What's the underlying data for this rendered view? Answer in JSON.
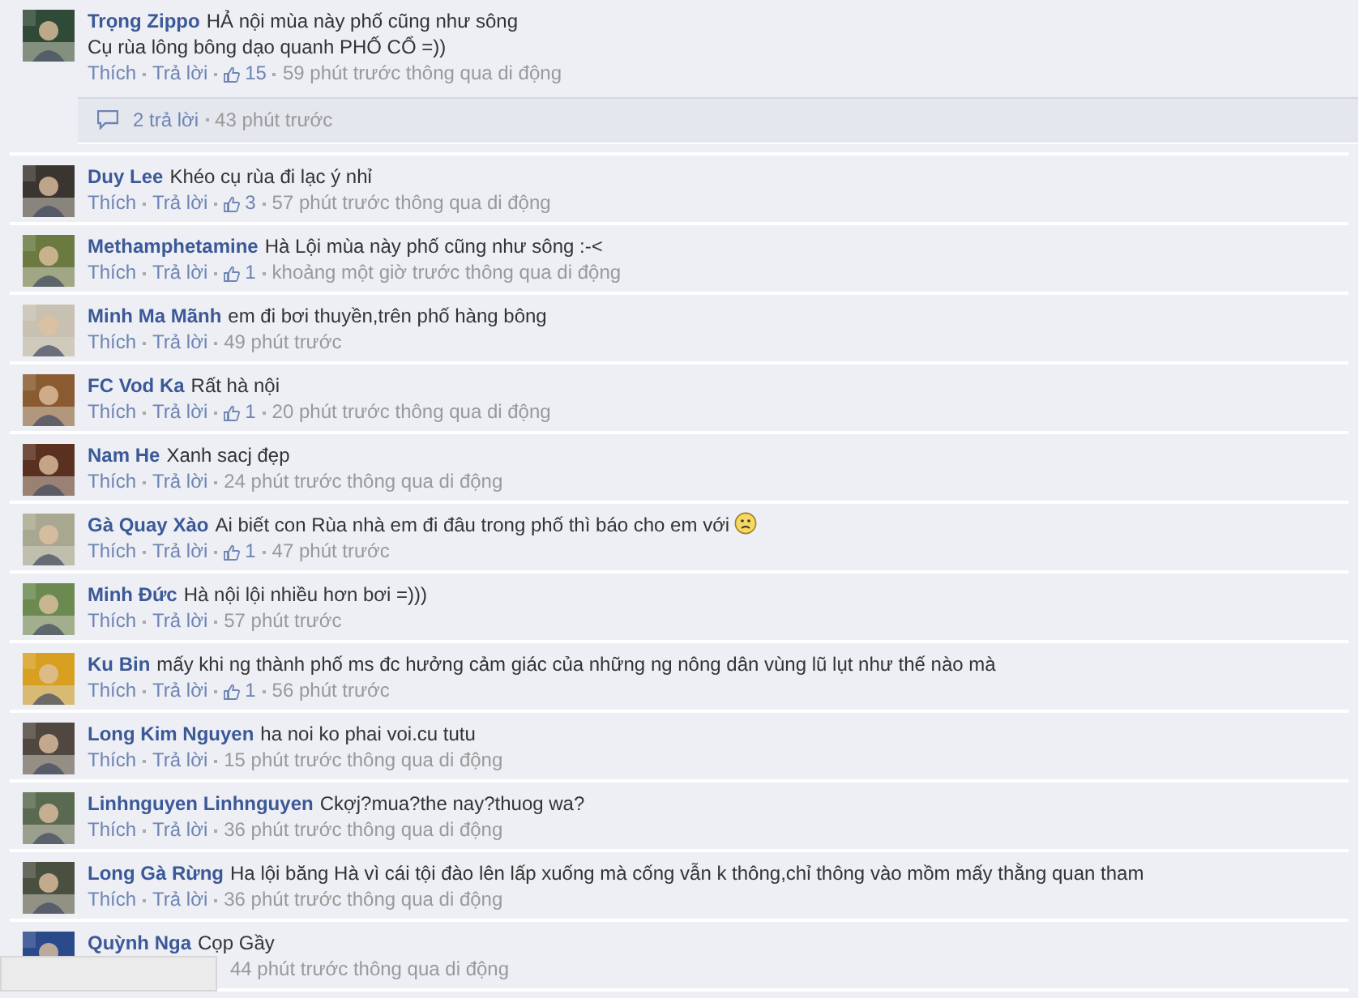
{
  "comments": [
    {
      "author": "Trọng Zippo",
      "lines": [
        "HẢ nội mùa này phố cũng như sông",
        "Cụ rùa lông bông dạo quanh PHỐ CỔ =))"
      ],
      "actions": [
        "Thích",
        "Trả lời"
      ],
      "likes": "15",
      "time": "59 phút trước thông qua di động",
      "replies": {
        "count": "2 trả lời",
        "time": "43 phút trước"
      }
    },
    {
      "author": "Duy Lee",
      "lines": [
        "Khéo cụ rùa đi lạc ý nhỉ"
      ],
      "actions": [
        "Thích",
        "Trả lời"
      ],
      "likes": "3",
      "time": "57 phút trước thông qua di động"
    },
    {
      "author": "Methamphetamine",
      "lines": [
        "Hà Lội mùa này phố cũng như sông :-<"
      ],
      "actions": [
        "Thích",
        "Trả lời"
      ],
      "likes": "1",
      "time": "khoảng một giờ trước thông qua di động"
    },
    {
      "author": "Minh Ma Mãnh",
      "lines": [
        "em đi bơi thuyền,trên phố hàng bông"
      ],
      "actions": [
        "Thích",
        "Trả lời"
      ],
      "time": "49 phút trước"
    },
    {
      "author": "FC Vod Ka",
      "lines": [
        "Rất hà nội"
      ],
      "actions": [
        "Thích",
        "Trả lời"
      ],
      "likes": "1",
      "time": "20 phút trước thông qua di động"
    },
    {
      "author": "Nam He",
      "lines": [
        "Xanh sacj đẹp"
      ],
      "actions": [
        "Thích",
        "Trả lời"
      ],
      "time": "24 phút trước thông qua di động"
    },
    {
      "author": "Gà Quay Xào",
      "lines": [
        "Ai biết con Rùa nhà em đi đâu trong phố thì báo cho em với"
      ],
      "emoticon": true,
      "actions": [
        "Thích",
        "Trả lời"
      ],
      "likes": "1",
      "time": "47 phút trước"
    },
    {
      "author": "Minh Đức",
      "lines": [
        "Hà nội lội nhiều hơn bơi =)))"
      ],
      "actions": [
        "Thích",
        "Trả lời"
      ],
      "time": "57 phút trước"
    },
    {
      "author": "Ku Bin",
      "lines": [
        "mấy khi ng thành phố ms đc hưởng cảm giác của những ng nông dân vùng lũ lụt như thế nào mà"
      ],
      "actions": [
        "Thích",
        "Trả lời"
      ],
      "likes": "1",
      "time": "56 phút trước"
    },
    {
      "author": "Long Kim Nguyen",
      "lines": [
        "ha noi ko phai voi.cu tutu"
      ],
      "actions": [
        "Thích",
        "Trả lời"
      ],
      "time": "15 phút trước thông qua di động"
    },
    {
      "author": "Linhnguyen Linhnguyen",
      "lines": [
        "Ckợj?mua?the nay?thuog wa?"
      ],
      "actions": [
        "Thích",
        "Trả lời"
      ],
      "time": "36 phút trước thông qua di động"
    },
    {
      "author": "Long Gà Rừng",
      "lines": [
        "Ha lội băng Hà vì cái tội đào lên lấp xuống mà cống vẫn k thông,chỉ thông vào mồm mấy thằng quan tham"
      ],
      "actions": [
        "Thích",
        "Trả lời"
      ],
      "time": "36 phút trước thông qua di động"
    },
    {
      "author": "Quỳnh Nga",
      "lines": [
        "Cọp Gầy"
      ],
      "covered": true,
      "time": "44 phút trước thông qua di động"
    }
  ]
}
